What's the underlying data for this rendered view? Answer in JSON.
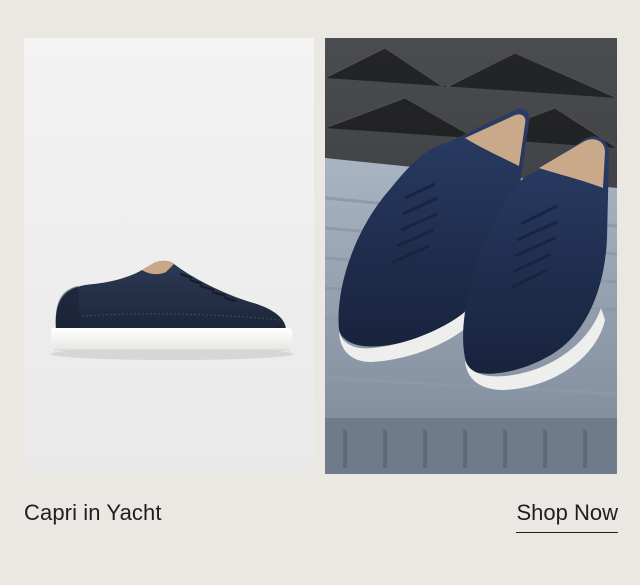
{
  "product": {
    "name": "Capri in Yacht"
  },
  "cta": {
    "label": "Shop Now"
  },
  "images": {
    "left": "product-shot-sneaker-side",
    "right": "lifestyle-shot-sneakers-on-suitcase"
  },
  "colors": {
    "background": "#ebe7e3",
    "sneaker_navy": "#233048",
    "sole_white": "#f4f4f2",
    "text": "#1f1f1f"
  }
}
